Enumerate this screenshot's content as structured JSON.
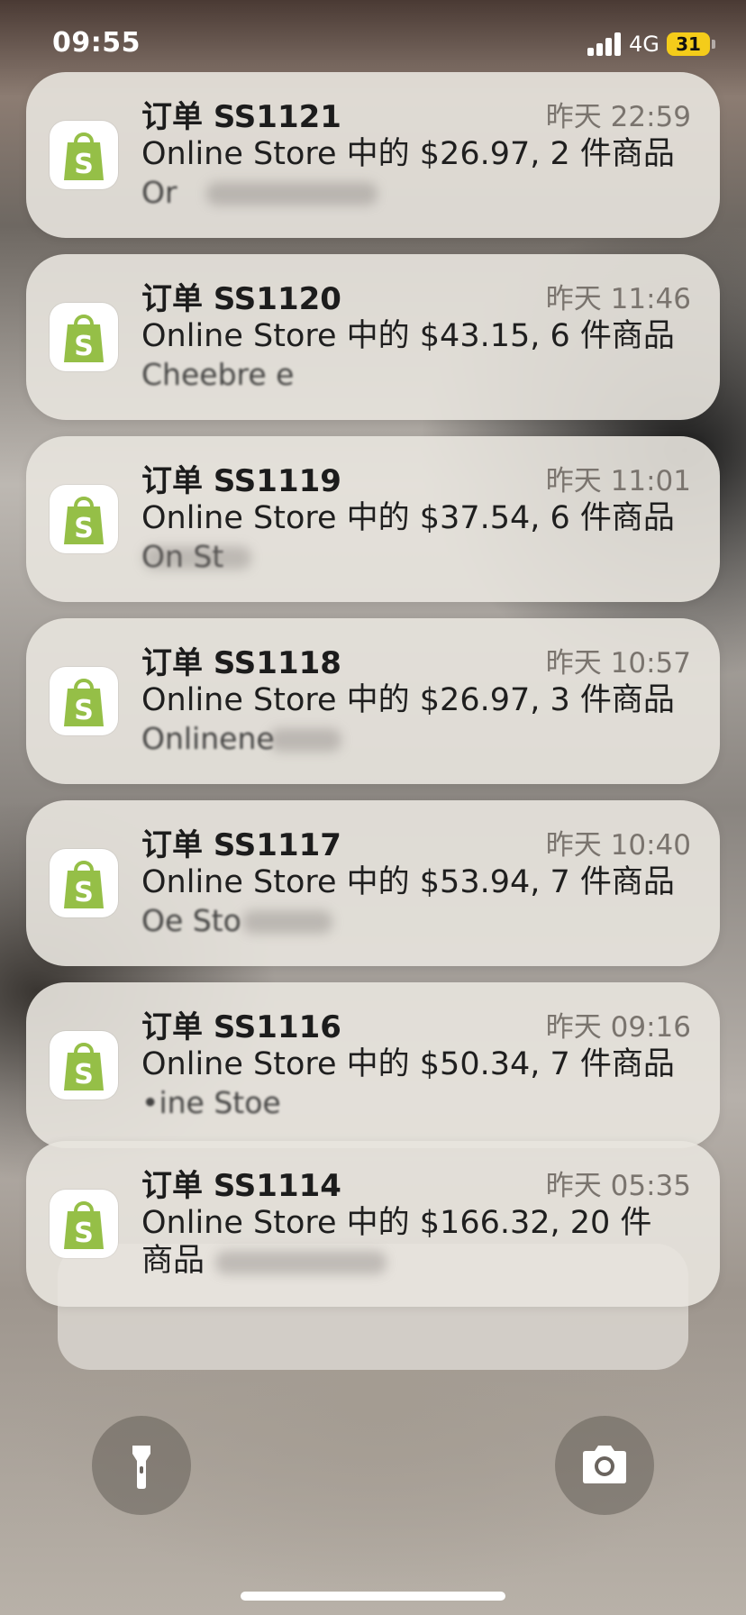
{
  "status_bar": {
    "time": "09:55",
    "network": "4G",
    "battery": "31"
  },
  "colors": {
    "shopify_green": "#95bf47",
    "battery_yellow": "#f4cc1a"
  },
  "notifications": [
    {
      "title": "订单 SS1121",
      "time": "昨天 22:59",
      "body": "Online Store 中的 $26.97, 2 件商品",
      "preview": "Or",
      "icon": "shopify-bag-icon"
    },
    {
      "title": "订单 SS1120",
      "time": "昨天 11:46",
      "body": "Online Store 中的 $43.15, 6 件商品",
      "preview": "Cheebre e",
      "icon": "shopify-bag-icon"
    },
    {
      "title": "订单 SS1119",
      "time": "昨天 11:01",
      "body": "Online Store 中的 $37.54, 6 件商品",
      "preview": "On    St",
      "icon": "shopify-bag-icon"
    },
    {
      "title": "订单 SS1118",
      "time": "昨天 10:57",
      "body": "Online Store 中的 $26.97, 3 件商品",
      "preview": "Onlinene",
      "icon": "shopify-bag-icon"
    },
    {
      "title": "订单 SS1117",
      "time": "昨天 10:40",
      "body": "Online Store 中的 $53.94, 7 件商品",
      "preview": "Oe Sto",
      "icon": "shopify-bag-icon"
    },
    {
      "title": "订单 SS1116",
      "time": "昨天 09:16",
      "body": "Online Store 中的 $50.34, 7 件商品",
      "preview": "•ine Stoe",
      "icon": "shopify-bag-icon"
    },
    {
      "title": "订单 SS1114",
      "time": "昨天 05:35",
      "body": "Online Store 中的 $166.32, 20 件",
      "body2": "商品",
      "icon": "shopify-bag-icon"
    }
  ],
  "controls": {
    "left": "flashlight-icon",
    "right": "camera-icon"
  }
}
